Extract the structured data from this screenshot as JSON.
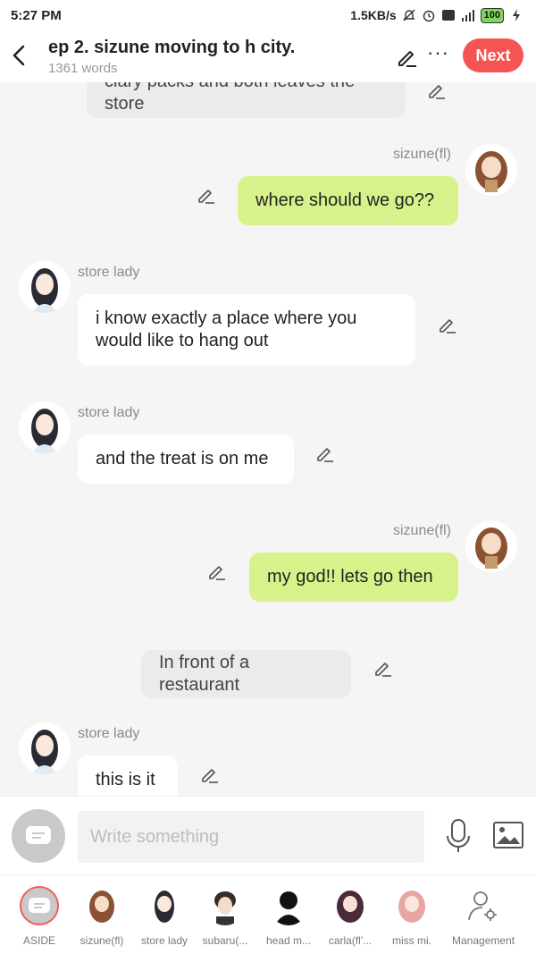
{
  "status": {
    "time": "5:27 PM",
    "net_speed": "1.5KB/s",
    "battery": "100"
  },
  "header": {
    "title": "ep 2. sizune moving to h city.",
    "word_count": "1361 words",
    "next_label": "Next"
  },
  "messages": [
    {
      "type": "narration",
      "text": "clary packs and both leaves the store"
    },
    {
      "type": "right",
      "name": "sizune(fl)",
      "text": "where should we go??"
    },
    {
      "type": "left",
      "name": "store lady",
      "line1": "i know exactly a place where you",
      "line2": "would like to hang out"
    },
    {
      "type": "left",
      "name": "store lady",
      "text": "and the treat is on me"
    },
    {
      "type": "right",
      "name": "sizune(fl)",
      "text": "my god!! lets go then"
    },
    {
      "type": "narration",
      "text": "In front of a restaurant"
    },
    {
      "type": "left",
      "name": "store lady",
      "text": "this is it"
    }
  ],
  "input": {
    "placeholder": "Write something"
  },
  "characters": [
    {
      "label": "ASIDE"
    },
    {
      "label": "sizune(fl)"
    },
    {
      "label": "store lady"
    },
    {
      "label": "subaru(..."
    },
    {
      "label": "head m..."
    },
    {
      "label": "carla(fl'..."
    },
    {
      "label": "miss mi."
    },
    {
      "label": "Management"
    }
  ],
  "colors": {
    "accent": "#f55452",
    "my_bubble": "#d8f28b",
    "other_bubble": "#ffffff",
    "narration_bubble": "#ebebeb"
  }
}
